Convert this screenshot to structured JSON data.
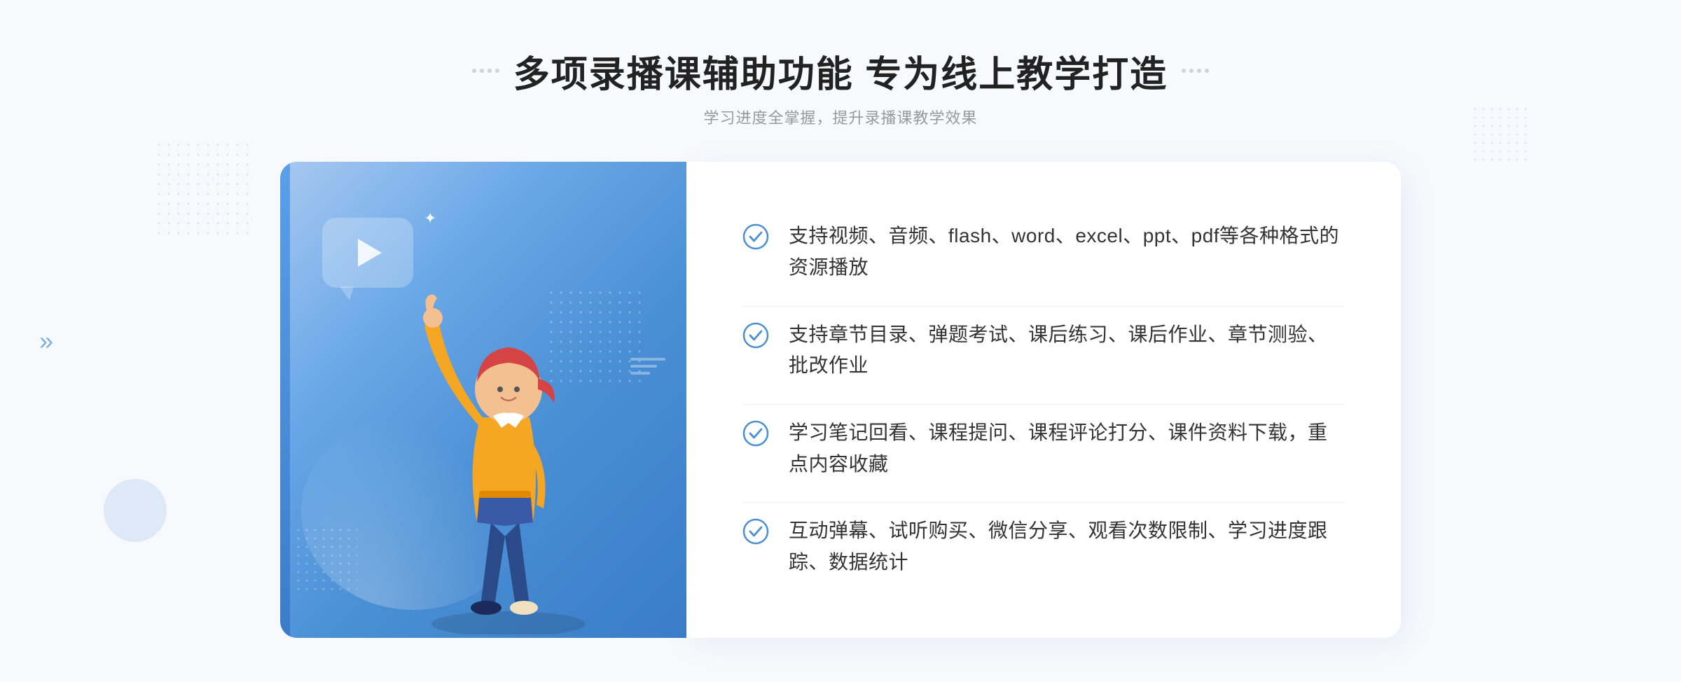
{
  "header": {
    "decorator_dots_left": "···",
    "decorator_dots_right": "···",
    "title": "多项录播课辅助功能 专为线上教学打造",
    "subtitle": "学习进度全掌握，提升录播课教学效果"
  },
  "features": [
    {
      "id": 1,
      "text": "支持视频、音频、flash、word、excel、ppt、pdf等各种格式的资源播放"
    },
    {
      "id": 2,
      "text": "支持章节目录、弹题考试、课后练习、课后作业、章节测验、批改作业"
    },
    {
      "id": 3,
      "text": "学习笔记回看、课程提问、课程评论打分、课件资料下载，重点内容收藏"
    },
    {
      "id": 4,
      "text": "互动弹幕、试听购买、微信分享、观看次数限制、学习进度跟踪、数据统计"
    }
  ],
  "colors": {
    "accent_blue": "#4a8fd4",
    "light_blue": "#a8c8f0",
    "check_color": "#4a8fd4",
    "text_primary": "#333333",
    "text_secondary": "#999999"
  },
  "illustration": {
    "play_label": "play",
    "chevron_left": "»",
    "chevron_right": "«"
  }
}
